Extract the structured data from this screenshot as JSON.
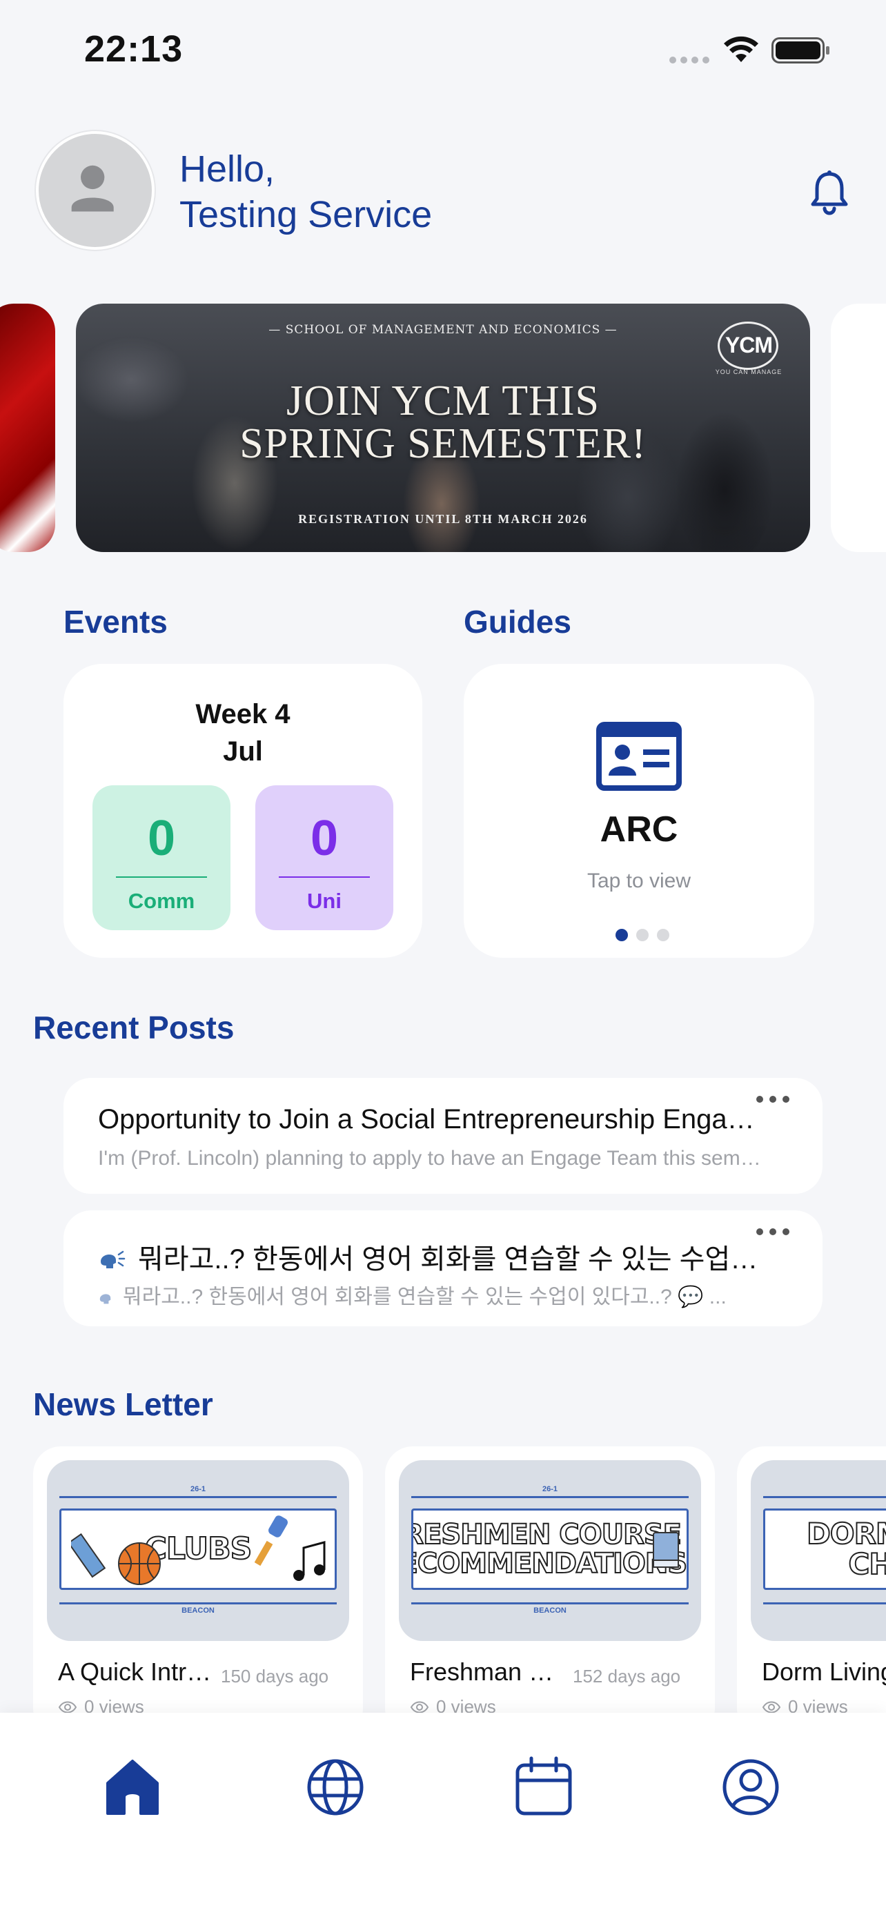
{
  "status_bar": {
    "time": "22:13"
  },
  "header": {
    "greeting_line1": "Hello,",
    "greeting_line2": "Testing Service",
    "icons": {
      "avatar": "person-avatar",
      "notification": "bell-icon"
    }
  },
  "banner": {
    "school": "— SCHOOL OF MANAGEMENT AND ECONOMICS —",
    "headline": "JOIN YCM THIS\nSPRING SEMESTER!",
    "registration": "REGISTRATION UNTIL 8TH MARCH 2026",
    "logo_text": "YCM",
    "logo_subtext": "YOU CAN MANAGE"
  },
  "events": {
    "section_title": "Events",
    "week": "Week 4\nJul",
    "comm": {
      "count": "0",
      "label": "Comm"
    },
    "uni": {
      "count": "0",
      "label": "Uni"
    }
  },
  "guides": {
    "section_title": "Guides",
    "title": "ARC",
    "subtitle": "Tap to view",
    "icon": "id-card-icon",
    "pager": {
      "total": 3,
      "active_index": 0
    }
  },
  "recent_posts": {
    "section_title": "Recent Posts",
    "items": [
      {
        "title": "Opportunity to Join a Social Entrepreneurship Engage Team",
        "excerpt": "I'm (Prof. Lincoln) planning to apply to have an Engage Team this semester"
      },
      {
        "title": "뭐라고..? 한동에서 영어 회화를 연습할 수 있는 수업이 있다고..?",
        "excerpt": "뭐라고..? 한동에서 영어 회화를 연습할 수 있는 수업이 있다고..? 💬 ...",
        "emoji": "speaking-head"
      }
    ]
  },
  "newsletter": {
    "section_title": "News Letter",
    "items": [
      {
        "title": "A Quick Introduction to Clubs",
        "date": "150 days ago",
        "views": "0 views",
        "thumb_tag_top": "26-1",
        "thumb_tag_bottom": "BEACON",
        "thumb_text": "CLUBS"
      },
      {
        "title": "Freshman Course Recommendations",
        "date": "152 days ago",
        "views": "0 views",
        "thumb_tag_top": "26-1",
        "thumb_tag_bottom": "BEACON",
        "thumb_text": "FRESHMEN COURSE\nRECOMMENDATIONS"
      },
      {
        "title": "Dorm Living Checklist",
        "date": "",
        "views": "0 views",
        "thumb_tag_top": "",
        "thumb_tag_bottom": "",
        "thumb_text": "DORM E\nCHEC"
      }
    ]
  },
  "tabbar": {
    "items": [
      {
        "icon": "home-icon",
        "active": true
      },
      {
        "icon": "globe-icon",
        "active": false
      },
      {
        "icon": "calendar-icon",
        "active": false
      },
      {
        "icon": "profile-icon",
        "active": false
      }
    ]
  },
  "colors": {
    "brand_blue": "#183c97",
    "comm_green": "#1aae78",
    "uni_purple": "#7b2ee8",
    "background": "#f5f6f9"
  }
}
